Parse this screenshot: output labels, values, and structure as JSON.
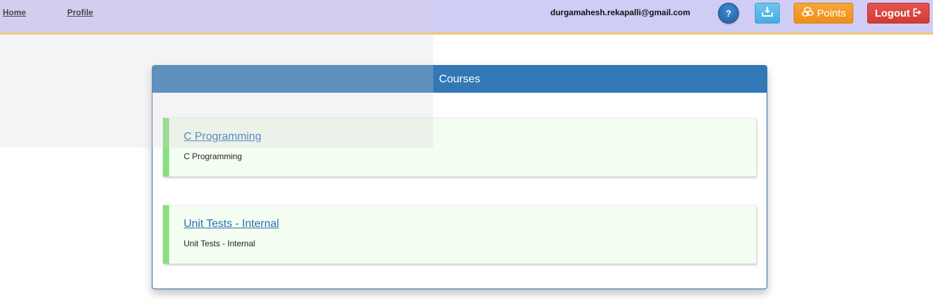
{
  "nav": {
    "home_label": "Home",
    "profile_label": "Profile"
  },
  "header": {
    "user_email": "durgamahesh.rekapalli@gmail.com",
    "help_label": "?",
    "points_label": "Points",
    "logout_label": "Logout",
    "icons": {
      "help": "question-icon",
      "download": "download-icon",
      "points": "coins-icon",
      "logout": "logout-icon"
    }
  },
  "courses": {
    "title": "Courses",
    "items": [
      {
        "title": "C Programming",
        "description": "C Programming"
      },
      {
        "title": "Unit Tests - Internal",
        "description": "Unit Tests - Internal"
      }
    ]
  },
  "colors": {
    "topbar": "#cfcdf6",
    "topbar_border": "#f6c66a",
    "panel_header": "#3378b6",
    "card_accent": "#86e07f",
    "card_bg": "#f3fdf1",
    "points_button": "#ee8f17",
    "logout_button": "#d33a34",
    "download_button": "#48ade0",
    "help_button": "#1f5fa8"
  }
}
